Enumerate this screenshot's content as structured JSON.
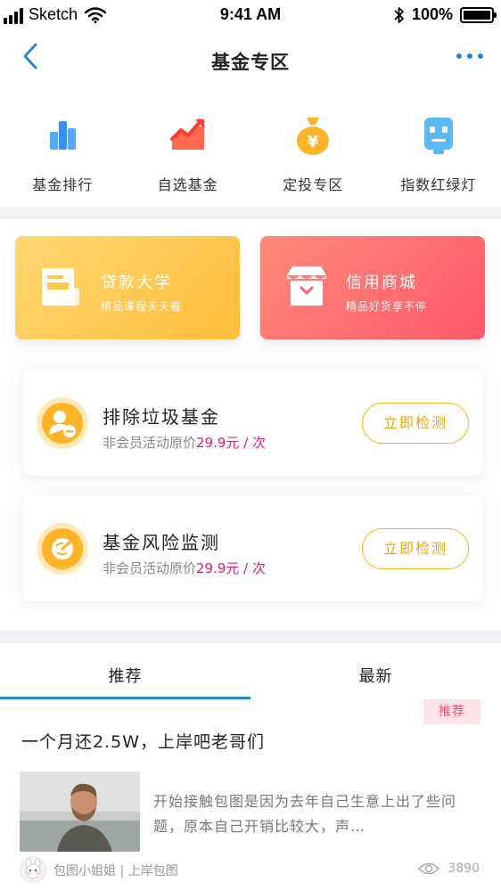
{
  "status_bar": {
    "carrier": "Sketch",
    "time": "9:41 AM",
    "battery": "100%"
  },
  "nav": {
    "title": "基金专区"
  },
  "quick_links": [
    {
      "label": "基金排行",
      "icon": "bar-chart-icon"
    },
    {
      "label": "自选基金",
      "icon": "trend-chart-icon"
    },
    {
      "label": "定投专区",
      "icon": "money-bag-icon"
    },
    {
      "label": "指数红绿灯",
      "icon": "robot-face-icon"
    }
  ],
  "promos": [
    {
      "title": "贷款大学",
      "subtitle": "精品课程天天看",
      "icon": "document-icon"
    },
    {
      "title": "信用商城",
      "subtitle": "精品好货享不停",
      "icon": "shop-icon"
    }
  ],
  "services": [
    {
      "title": "排除垃圾基金",
      "desc_prefix": "非会员活动原价",
      "price": "29.9元 / 次",
      "button": "立即检测",
      "icon": "user-minus-icon"
    },
    {
      "title": "基金风险监测",
      "desc_prefix": "非会员活动原价",
      "price": "29.9元 / 次",
      "button": "立即检测",
      "icon": "radar-icon"
    }
  ],
  "tabs": [
    {
      "label": "推荐",
      "active": true
    },
    {
      "label": "最新",
      "active": false
    }
  ],
  "article": {
    "badge": "推荐",
    "title": "一个月还2.5W，上岸吧老哥们",
    "excerpt": "开始接触包图是因为去年自己生意上出了些问题，原本自己开销比较大，声…",
    "author": "包图小姐姐 | 上岸包图",
    "views": "3890"
  },
  "colors": {
    "accent": "#1e88d6",
    "gold": "#ffb428",
    "price": "#e8177a"
  }
}
